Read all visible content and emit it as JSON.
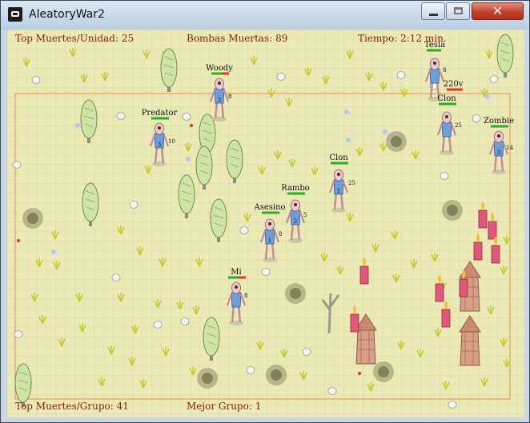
{
  "window": {
    "title": "AleatoryWar2",
    "icon": "app-icon",
    "controls": {
      "minimize": "minimize-icon",
      "maximize": "maximize-icon",
      "close": "close-icon"
    }
  },
  "hud": {
    "top_kills_unit": "Top Muertes/Unidad: 25",
    "bombs_dead": "Bombas Muertas: 89",
    "time": "Tiempo: 2:12 min.",
    "top_kills_group": "Top Muertes/Grupo: 41",
    "best_group": "Mejor Grupo: 1"
  },
  "colors": {
    "hud_text": "#8a1f10",
    "ground": "#eceab8",
    "border_line": "#f08a4a",
    "health_green": "#2bb021",
    "health_red": "#e03a1c"
  },
  "units": [
    {
      "name": "Woody",
      "team": "3",
      "level": "8"
    },
    {
      "name": "Predator",
      "team": "3",
      "level": "10"
    },
    {
      "name": "Tesla",
      "team": "",
      "level": "8"
    },
    {
      "name": "220v",
      "team": "",
      "level": ""
    },
    {
      "name": "Clon",
      "team": "",
      "level": "25"
    },
    {
      "name": "Zombie",
      "team": "3",
      "level": "14"
    },
    {
      "name": "Clon",
      "team": "1",
      "level": "25"
    },
    {
      "name": "Rambo",
      "team": "2",
      "level": "5"
    },
    {
      "name": "Asesino",
      "team": "1",
      "level": "8"
    },
    {
      "name": "Mi",
      "team": "",
      "level": "8"
    }
  ]
}
